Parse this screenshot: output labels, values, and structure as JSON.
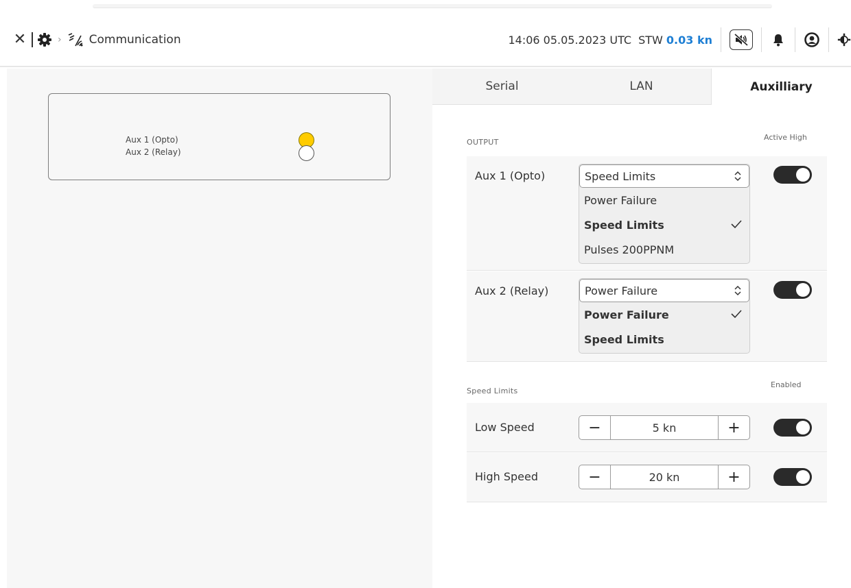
{
  "header": {
    "breadcrumb_label": "Communication",
    "time": "14:06 05.05.2023 UTC",
    "stw_label": "STW",
    "stw_value": "0.03 kn"
  },
  "icons": {
    "close": "close-icon",
    "gear": "gear-icon",
    "chevron": "chevron-right-icon",
    "communication": "communication-icon",
    "mute": "mute-icon",
    "bell": "bell-icon",
    "user": "user-icon",
    "brightness": "brightness-icon"
  },
  "colors": {
    "accent": "#1e7fd4",
    "led_active": "#ffcc00",
    "toggle_on": "#2a2a2a"
  },
  "left_panel": {
    "aux1_label": "Aux 1 (Opto)",
    "aux2_label": "Aux 2 (Relay)",
    "aux1_active": true,
    "aux2_active": false
  },
  "tabs": [
    {
      "label": "Serial",
      "active": false
    },
    {
      "label": "LAN",
      "active": false
    },
    {
      "label": "Auxilliary",
      "active": true
    }
  ],
  "output": {
    "section_label": "OUTPUT",
    "column_label": "Active High",
    "rows": [
      {
        "label": "Aux 1 (Opto)",
        "selected": "Speed Limits",
        "options": [
          "Power Failure",
          "Speed Limits",
          "Pulses 200PPNM"
        ],
        "active_high": true
      },
      {
        "label": "Aux 2 (Relay)",
        "selected": "Power Failure",
        "options": [
          "Power Failure",
          "Speed Limits"
        ],
        "active_high": true
      }
    ]
  },
  "speed_limits": {
    "section_label": "Speed Limits",
    "column_label": "Enabled",
    "rows": [
      {
        "label": "Low Speed",
        "value": "5 kn",
        "enabled": true
      },
      {
        "label": "High Speed",
        "value": "20 kn",
        "enabled": true
      }
    ],
    "minus_label": "−",
    "plus_label": "+"
  }
}
